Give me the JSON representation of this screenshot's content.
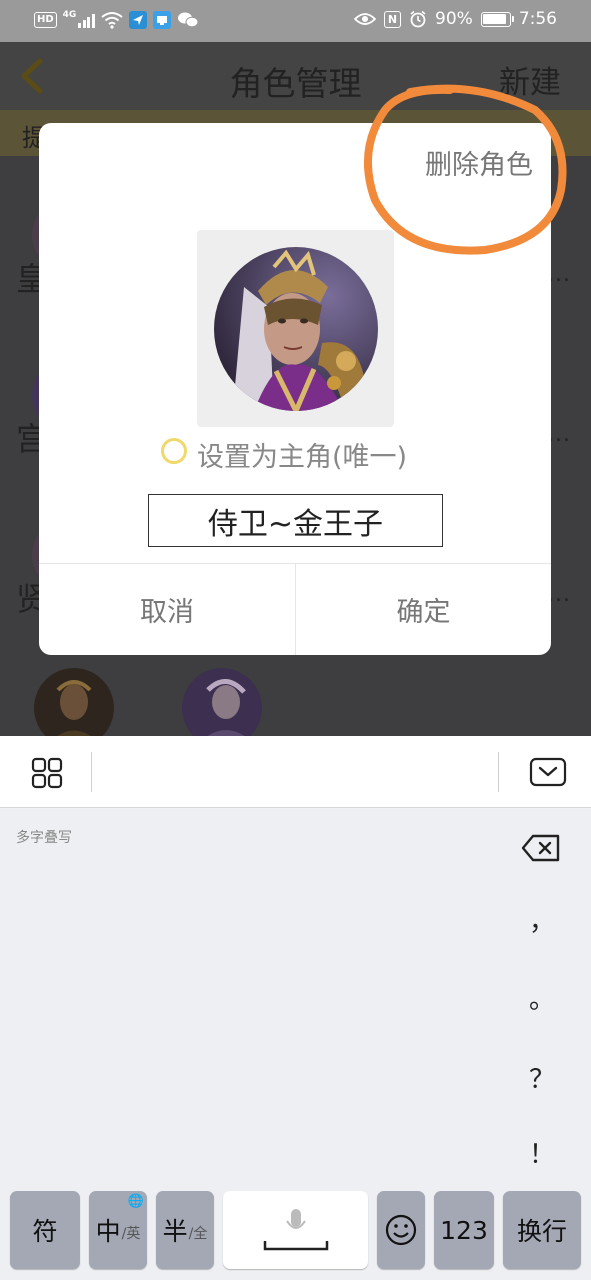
{
  "status_bar": {
    "hd": "HD",
    "network": "4G",
    "battery": "90%",
    "time": "7:56",
    "nfc": "N"
  },
  "app": {
    "title": "角色管理",
    "new_label": "新建",
    "hint_text": "提",
    "roles": [
      {
        "name": "皇"
      },
      {
        "name": "宫"
      },
      {
        "name": "贤"
      }
    ],
    "more": "..."
  },
  "dialog": {
    "delete_label": "删除角色",
    "set_main_label": "设置为主角(唯一)",
    "set_main_checked": false,
    "name_value": "侍卫~金王子",
    "cancel_label": "取消",
    "confirm_label": "确定",
    "highlight_color": "#f28a3c",
    "radio_color": "#f0d96a"
  },
  "keyboard": {
    "hint": "多字叠写",
    "punctuation": [
      "，",
      "。",
      "？",
      "！"
    ],
    "keys": {
      "symbol": "符",
      "chinese": "中",
      "chinese_sub": "/英",
      "half": "半",
      "half_sub": "/全",
      "numbers": "123",
      "enter": "换行"
    }
  },
  "icons": [
    "back-chevron-icon",
    "grid-icon",
    "keyboard-hide-icon",
    "backspace-icon",
    "microphone-icon",
    "emoji-icon",
    "globe-icon",
    "eye-icon",
    "alarm-icon",
    "wifi-icon"
  ]
}
